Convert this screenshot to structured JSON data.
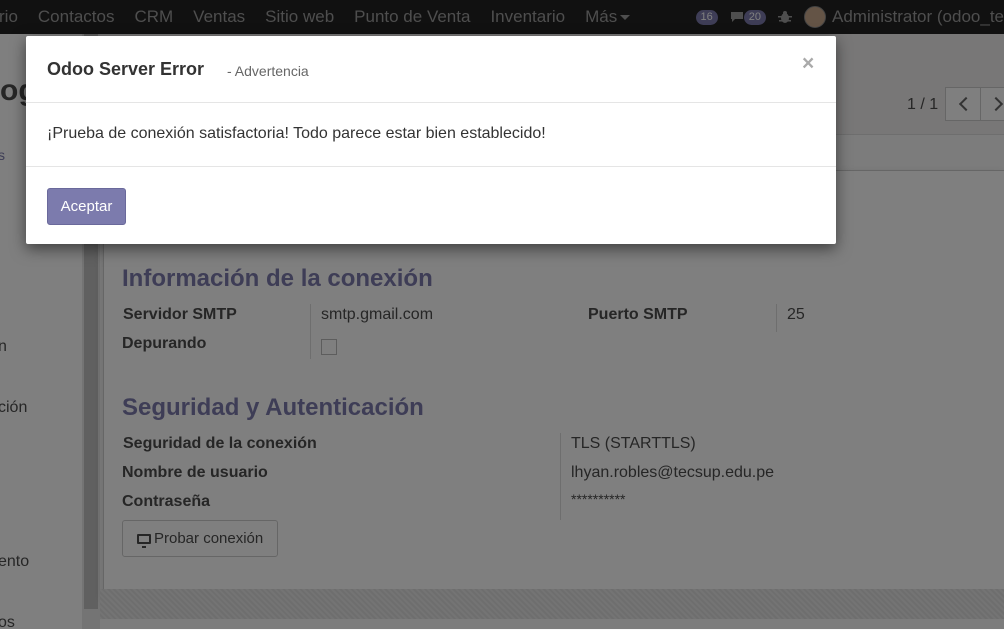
{
  "navbar": {
    "items": [
      "rio",
      "Contactos",
      "CRM",
      "Ventas",
      "Sitio web",
      "Punto de Venta",
      "Inventario",
      "Más"
    ],
    "activity_count": "16",
    "message_count": "20",
    "user": "Administrator (odoo_te"
  },
  "left_panel": {
    "items": [
      "s",
      "n",
      "ción",
      "ento",
      "os"
    ]
  },
  "control_panel": {
    "title": "og",
    "pager": "1 / 1"
  },
  "form": {
    "section_connection": "Información de la conexión",
    "smtp_server_label": "Servidor SMTP",
    "smtp_server_value": "smtp.gmail.com",
    "smtp_port_label": "Puerto SMTP",
    "smtp_port_value": "25",
    "debug_label": "Depurando",
    "section_security": "Seguridad y Autenticación",
    "conn_security_label": "Seguridad de la conexión",
    "conn_security_value": "TLS (STARTTLS)",
    "username_label": "Nombre de usuario",
    "username_value": "lhyan.robles@tecsup.edu.pe",
    "password_label": "Contraseña",
    "password_value": "**********",
    "test_button": "Probar conexión"
  },
  "modal": {
    "title": "Odoo Server Error",
    "subtitle": "- Advertencia",
    "close": "×",
    "message": "¡Prueba de conexión satisfactoria! Todo parece estar bien establecido!",
    "accept_button": "Aceptar"
  },
  "colors": {
    "brand": "#7c7bad",
    "navbar": "#222222"
  }
}
